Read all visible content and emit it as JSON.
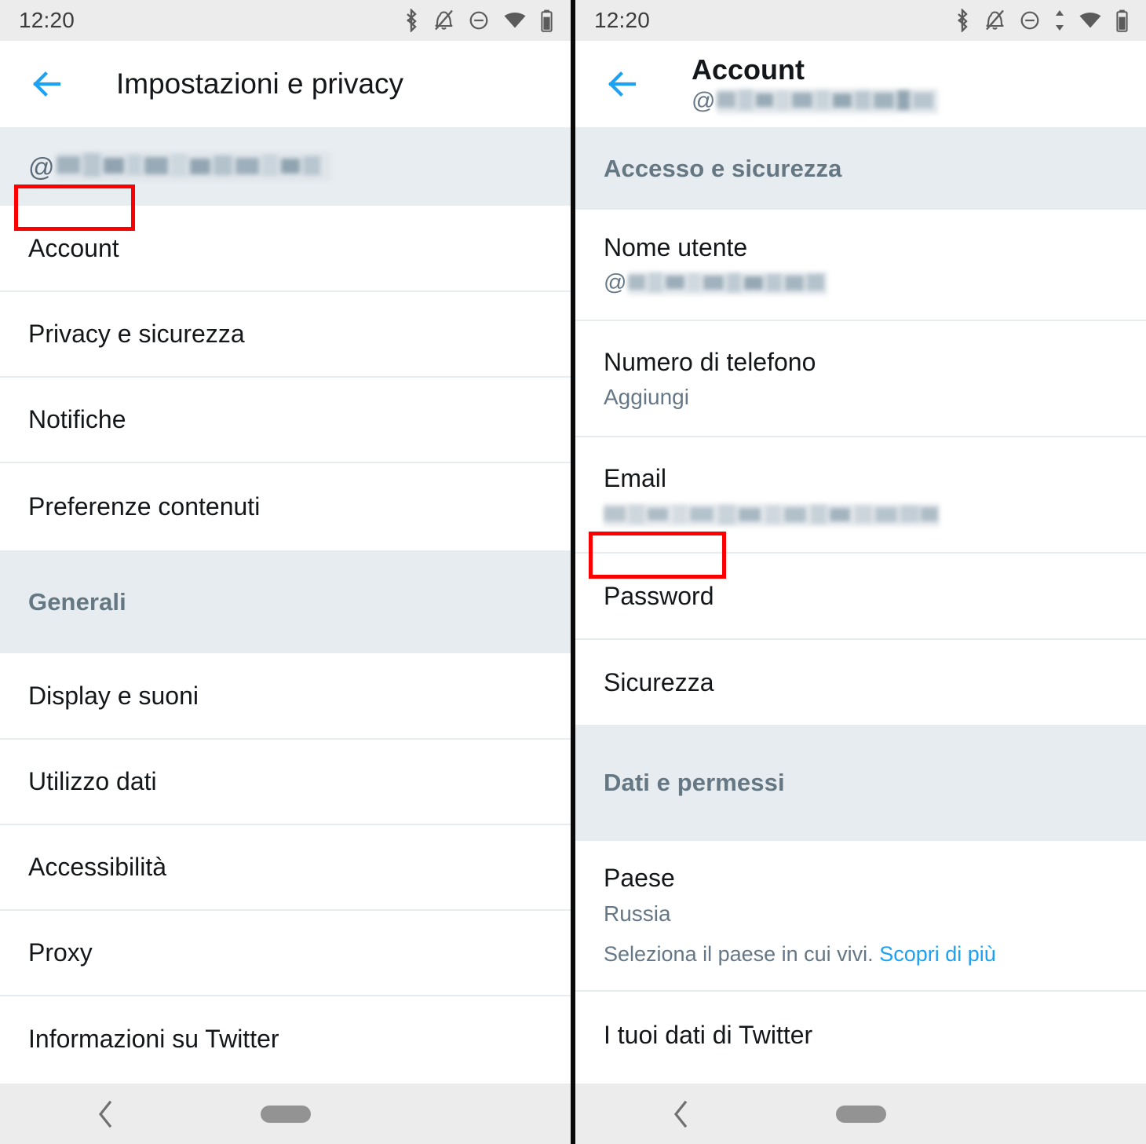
{
  "left": {
    "statusbar": {
      "time": "12:20",
      "icons": [
        "bluetooth-icon",
        "notifications-muted-icon",
        "do-not-disturb-icon",
        "wifi-icon",
        "battery-icon"
      ]
    },
    "appbar": {
      "title": "Impostazioni e privacy",
      "back_label": "Indietro"
    },
    "account_chip": {
      "at": "@",
      "username_redacted": true
    },
    "items": [
      {
        "label": "Account",
        "highlighted": true
      },
      {
        "label": "Privacy e sicurezza",
        "highlighted": false
      },
      {
        "label": "Notifiche",
        "highlighted": false
      },
      {
        "label": "Preferenze contenuti",
        "highlighted": false
      }
    ],
    "section_generali": "Generali",
    "general_items": [
      {
        "label": "Display e suoni"
      },
      {
        "label": "Utilizzo dati"
      },
      {
        "label": "Accessibilità"
      },
      {
        "label": "Proxy"
      },
      {
        "label": "Informazioni su Twitter"
      }
    ]
  },
  "right": {
    "statusbar": {
      "time": "12:20",
      "icons": [
        "bluetooth-icon",
        "notifications-muted-icon",
        "do-not-disturb-icon",
        "data-transfer-icon",
        "wifi-icon",
        "battery-icon"
      ]
    },
    "appbar": {
      "title": "Account",
      "at": "@",
      "username_redacted": true,
      "back_label": "Indietro"
    },
    "section_accesso": "Accesso e sicurezza",
    "access_items": [
      {
        "label": "Nome utente",
        "value_at": "@",
        "value_redacted": true
      },
      {
        "label": "Numero di telefono",
        "value": "Aggiungi"
      },
      {
        "label": "Email",
        "value_redacted": true
      },
      {
        "label": "Password",
        "highlighted": true
      },
      {
        "label": "Sicurezza"
      }
    ],
    "section_dati": "Dati e permessi",
    "data_items": [
      {
        "label": "Paese",
        "value": "Russia",
        "note": "Seleziona il paese in cui vivi.",
        "note_link": "Scopri di più"
      },
      {
        "label": "I tuoi dati di Twitter"
      }
    ]
  },
  "colors": {
    "accent": "#1da1f2",
    "highlight_box": "#fc0000",
    "section_bg": "#e6ecf0",
    "section_text": "#647782",
    "divider": "#e7ecf0",
    "text_primary": "#14171a",
    "text_secondary": "#657786",
    "statusbar_bg": "#ececec",
    "navbar_bg": "#ececec"
  }
}
